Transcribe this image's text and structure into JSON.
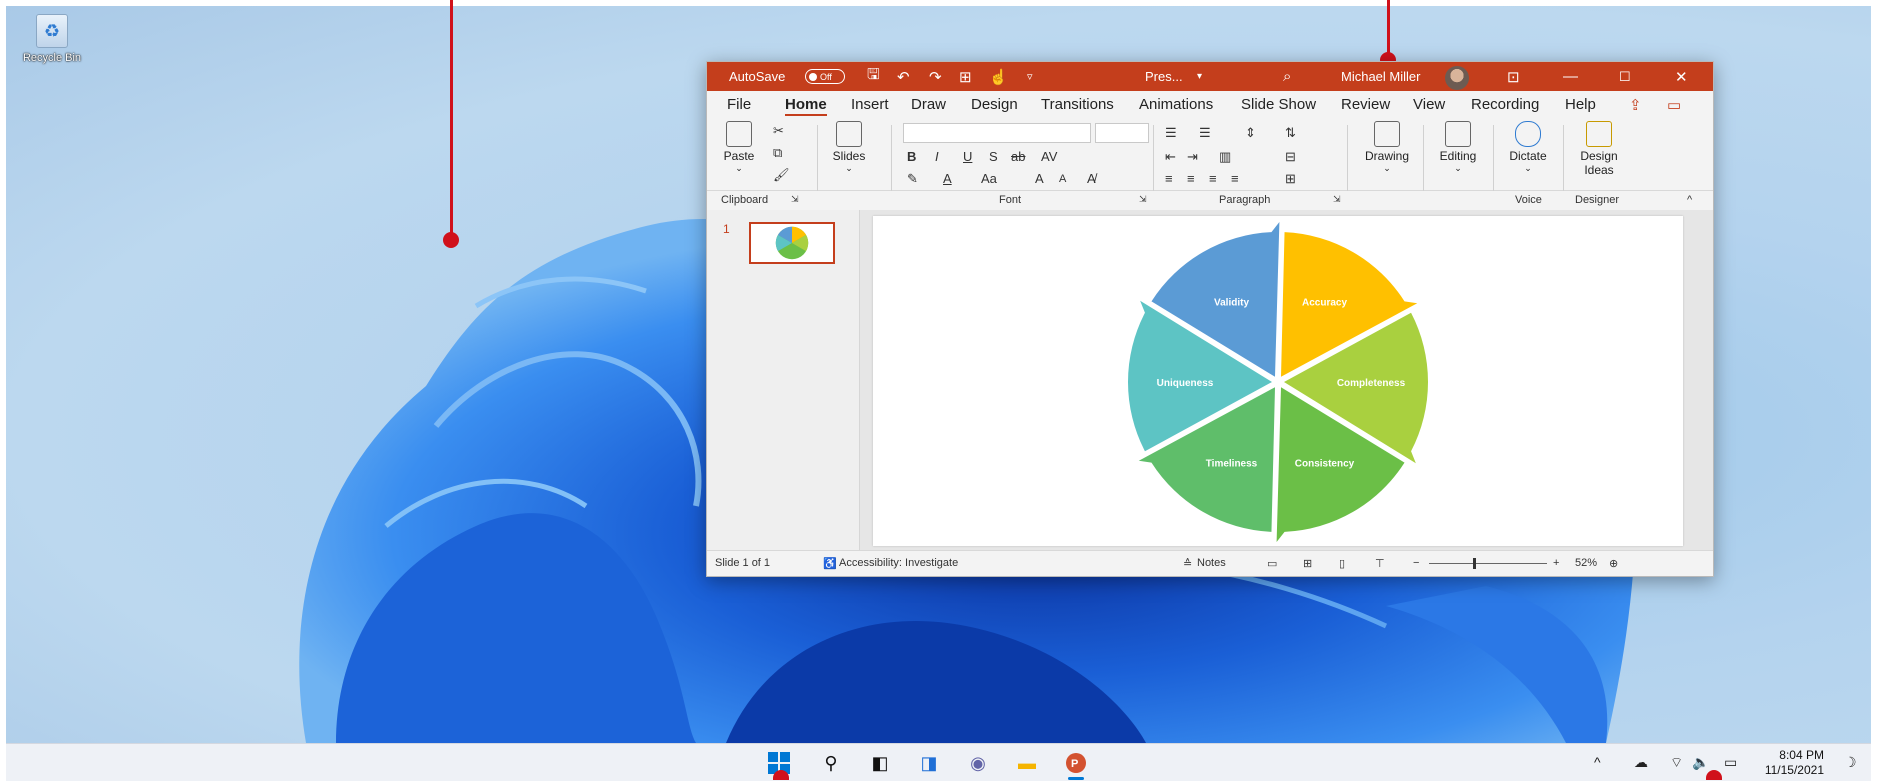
{
  "desktop": {
    "recycle_bin_label": "Recycle Bin"
  },
  "ppt": {
    "autosave_label": "AutoSave",
    "autosave_state": "Off",
    "file_name": "Pres...",
    "user_name": "Michael Miller",
    "tabs": [
      "File",
      "Home",
      "Insert",
      "Draw",
      "Design",
      "Transitions",
      "Animations",
      "Slide Show",
      "Review",
      "View",
      "Recording",
      "Help"
    ],
    "ribbon": {
      "paste": "Paste",
      "slides": "Slides",
      "drawing": "Drawing",
      "editing": "Editing",
      "dictate": "Dictate",
      "design_ideas_1": "Design",
      "design_ideas_2": "Ideas",
      "bold": "B",
      "italic": "I",
      "underline": "U",
      "strike": "S",
      "strike2": "ab",
      "av": "AV",
      "aa": "Aa",
      "grow": "A",
      "shrink": "A"
    },
    "group_labels": {
      "clipboard": "Clipboard",
      "font": "Font",
      "paragraph": "Paragraph",
      "voice": "Voice",
      "designer": "Designer"
    },
    "slide_number": "1",
    "diagram_segments": [
      "Validity",
      "Accuracy",
      "Completeness",
      "Consistency",
      "Timeliness",
      "Uniqueness"
    ],
    "segment_colors": [
      "#5b9bd5",
      "#ffc000",
      "#a9d03f",
      "#6bbf47",
      "#5fbe6a",
      "#5dc4c4"
    ],
    "status": {
      "slide_of": "Slide 1 of 1",
      "accessibility": "Accessibility: Investigate",
      "notes": "Notes",
      "zoom": "52%"
    }
  },
  "taskbar": {
    "time": "8:04 PM",
    "date": "11/15/2021"
  }
}
